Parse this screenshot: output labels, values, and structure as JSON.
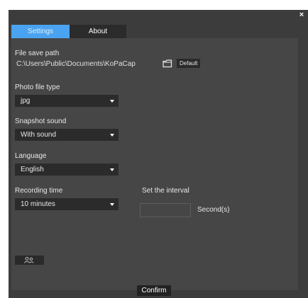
{
  "window": {
    "close_glyph": "×"
  },
  "tabs": [
    {
      "label": "Settings",
      "active": true
    },
    {
      "label": "About",
      "active": false
    }
  ],
  "file_save_path": {
    "label": "File save path",
    "value": "C:\\Users\\Public\\Documents\\KoPaCap",
    "browse_icon": "folder-icon",
    "default_label": "Default"
  },
  "photo_file_type": {
    "label": "Photo file type",
    "selected": "jpg"
  },
  "snapshot_sound": {
    "label": "Snapshot sound",
    "selected": "With sound"
  },
  "language": {
    "label": "Language",
    "selected": "English"
  },
  "recording_time": {
    "label": "Recording time",
    "selected": "10 minutes"
  },
  "interval": {
    "label": "Set the interval",
    "value": "",
    "unit": "Second(s)"
  },
  "footer": {
    "confirm_label": "Confirm"
  },
  "colors": {
    "dialog_bg": "#3c3c3c",
    "panel_bg": "#464646",
    "control_bg": "#2b2b2b",
    "active_tab": "#4aa3f0"
  }
}
